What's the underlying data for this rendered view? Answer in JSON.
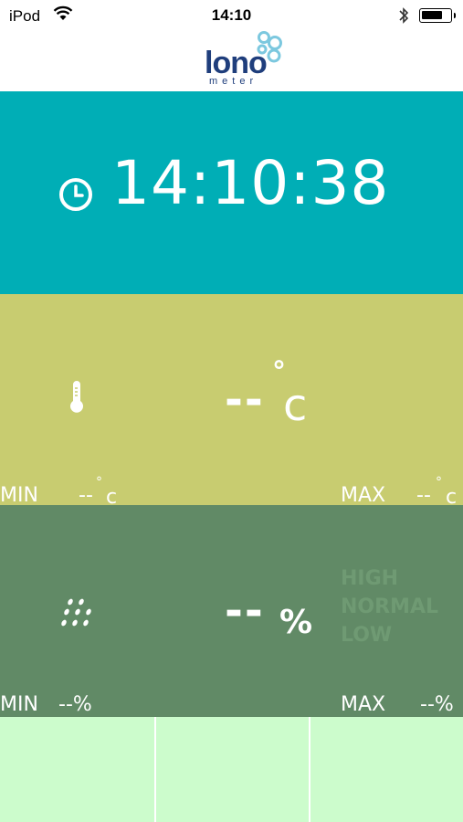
{
  "status_bar": {
    "carrier": "iPod",
    "time": "14:10"
  },
  "header": {
    "logo_word": "lono",
    "logo_sub": "meter"
  },
  "time_panel": {
    "value": "14:10:38",
    "icon": "clock-icon",
    "color": "#00aeb6"
  },
  "temperature_panel": {
    "value": "--",
    "unit_degree": "°",
    "unit": "c",
    "min_label": "MIN",
    "min_value": "--",
    "min_deg": "°",
    "min_unit": "c",
    "max_label": "MAX",
    "max_value": "--",
    "max_deg": "°",
    "max_unit": "c",
    "icon": "thermometer-icon",
    "color": "#c8cc70"
  },
  "humidity_panel": {
    "value": "--",
    "unit": "%",
    "legend": [
      "HIGH",
      "NORMAL",
      "LOW"
    ],
    "min_label": "MIN",
    "min_value": "--%",
    "max_label": "MAX",
    "max_value": "--%",
    "icon": "rain-icon",
    "color": "#618a66"
  },
  "bottom_panel": {
    "color": "#ccfccc"
  }
}
